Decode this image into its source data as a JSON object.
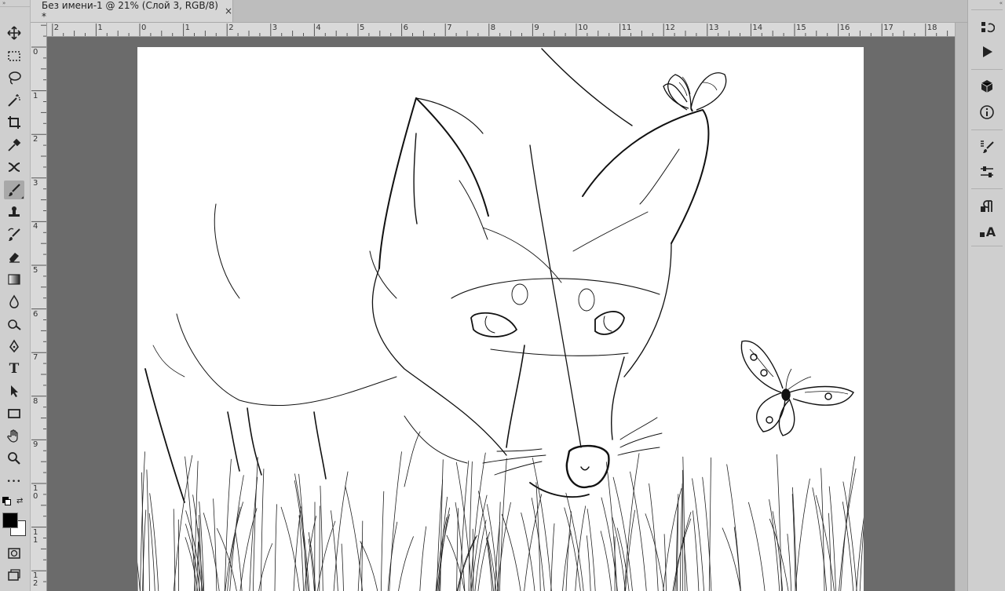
{
  "document_tab": {
    "title": "Без имени-1 @ 21% (Слой 3, RGB/8) *",
    "close_glyph": "×"
  },
  "ruler": {
    "top_labels": [
      "2",
      "1",
      "0",
      "1",
      "2",
      "3",
      "4",
      "5",
      "6",
      "7",
      "8",
      "9",
      "10",
      "11",
      "12",
      "13",
      "14",
      "15",
      "16",
      "17",
      "18"
    ],
    "left_labels": [
      "0",
      "1",
      "2",
      "3",
      "4",
      "5",
      "6",
      "7",
      "8",
      "9",
      "1\n0",
      "1\n1",
      "1\n2"
    ]
  },
  "tools": [
    {
      "name": "move-tool",
      "icon": "move-icon"
    },
    {
      "name": "marquee-tool",
      "icon": "rect-marquee-icon"
    },
    {
      "name": "lasso-tool",
      "icon": "lasso-icon"
    },
    {
      "name": "magic-wand-tool",
      "icon": "magic-wand-icon"
    },
    {
      "name": "crop-tool",
      "icon": "crop-icon"
    },
    {
      "name": "eyedropper-tool",
      "icon": "eyedropper-icon"
    },
    {
      "name": "healing-tool",
      "icon": "healing-icon"
    },
    {
      "name": "brush-tool",
      "icon": "brush-icon",
      "active": true
    },
    {
      "name": "stamp-tool",
      "icon": "stamp-icon"
    },
    {
      "name": "history-brush-tool",
      "icon": "history-brush-icon"
    },
    {
      "name": "eraser-tool",
      "icon": "eraser-icon"
    },
    {
      "name": "gradient-tool",
      "icon": "gradient-icon"
    },
    {
      "name": "blur-tool",
      "icon": "drop-icon"
    },
    {
      "name": "dodge-tool",
      "icon": "dodge-icon"
    },
    {
      "name": "pen-tool",
      "icon": "pen-icon"
    },
    {
      "name": "type-tool",
      "icon": "type-icon",
      "glyph": "T"
    },
    {
      "name": "path-selection-tool",
      "icon": "arrow-icon"
    },
    {
      "name": "shape-tool",
      "icon": "rectangle-icon"
    },
    {
      "name": "hand-tool",
      "icon": "hand-icon"
    },
    {
      "name": "zoom-tool",
      "icon": "zoom-icon"
    },
    {
      "name": "more-tools",
      "icon": "ellipsis-icon",
      "glyph": "•••"
    }
  ],
  "colors": {
    "foreground": "#000000",
    "background": "#ffffff"
  },
  "right_panel": [
    {
      "name": "history-panel-button",
      "icon": "history-icon"
    },
    {
      "name": "actions-panel-button",
      "icon": "play-icon"
    },
    {
      "name": "3d-panel-button",
      "icon": "cube-icon"
    },
    {
      "name": "info-panel-button",
      "icon": "info-icon"
    },
    {
      "name": "brushes-panel-button",
      "icon": "brush-settings-icon"
    },
    {
      "name": "adjust-panel-button",
      "icon": "sliders-icon"
    },
    {
      "name": "paragraph-panel-button",
      "icon": "paragraph-icon"
    },
    {
      "name": "character-panel-button",
      "icon": "character-icon",
      "glyph": "A"
    }
  ]
}
